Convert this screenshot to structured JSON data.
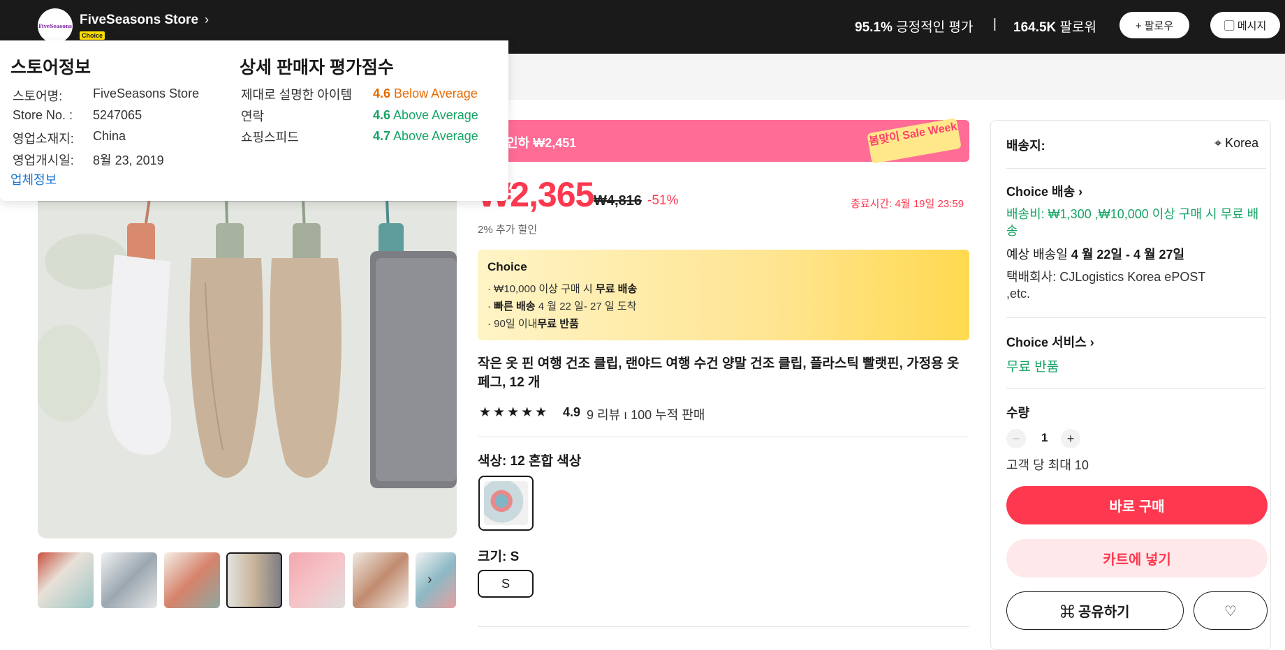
{
  "header": {
    "store_logo_text": "FiveSeasons",
    "store_name": "FiveSeasons Store",
    "choice_badge": "Choice",
    "positive_rate": "95.1%",
    "positive_label": " 긍정적인 평가",
    "separator": "|",
    "followers": "164.5K",
    "followers_label": " 팔로워",
    "follow_button": "+ 팔로우",
    "message_button": "▢ 메시지"
  },
  "store_popover": {
    "info_heading": "스토어정보",
    "info_rows": [
      {
        "label": "스토어명:",
        "value": "FiveSeasons Store"
      },
      {
        "label": "Store No. :",
        "value": "5247065"
      },
      {
        "label": "영업소재지:",
        "value": "China"
      },
      {
        "label": "영업개시일:",
        "value": "8월 23, 2019"
      }
    ],
    "business_info_link": "업체정보",
    "score_heading": "상세 판매자 평가점수",
    "scores": [
      {
        "label": "제대로 설명한 아이템",
        "score": "4.6",
        "status": "Below Average",
        "color": "#e66a00"
      },
      {
        "label": "연락",
        "score": "4.6",
        "status": "Above Average",
        "color": "#17a365"
      },
      {
        "label": "쇼핑스피드",
        "score": "4.7",
        "status": "Above Average",
        "color": "#17a365"
      }
    ]
  },
  "gallery": {
    "thumbnail_count": 7,
    "active_index": 3,
    "next_icon": "chevron-right-icon"
  },
  "product": {
    "promo_text": "가격인하 ₩2,451",
    "promo_tag": "봄맞이 Sale Week",
    "price": "₩2,365",
    "original_price": "₩4,816",
    "discount": "-51%",
    "end_time": "종료시간: 4월 19일 23:59",
    "extra_discount": "2% 추가 할인",
    "choice_title": "Choice",
    "choice_items": [
      {
        "pre": "· ₩10,000 이상 구매 시 ",
        "bold": "무료 배송",
        "post": ""
      },
      {
        "pre": "· ",
        "bold": "빠른 배송",
        "post": " 4 월 22 일- 27 일 도착"
      },
      {
        "pre": "· 90일 이내",
        "bold": "무료 반품",
        "post": ""
      }
    ],
    "title": "작은 옷 핀 여행 건조 클립, 랜야드 여행 수건 양말 건조 클립, 플라스틱 빨랫핀, 가정용 옷 페그, 12 개",
    "stars": "★★★★★",
    "rating": "4.9",
    "reviews": "9 리뷰  ı  100 누적 판매",
    "color_label": "색상: 12 혼합 색상",
    "size_label": "크기: S",
    "size_option": "S"
  },
  "shipping_panel": {
    "ship_to_label": "배송지:",
    "ship_to_value": "⌖ Korea",
    "choice_delivery": "Choice 배송  ›",
    "shipping_fee": "배송비: ₩1,300  ,₩10,000 이상 구매 시 무료 배송",
    "estimated_label": "예상 배송일 ",
    "estimated_value": "4 월 22일 - 4 월 27일",
    "courier": "택배회사: CJLogistics  Korea ePOST ,etc.",
    "choice_service": "Choice 서비스  ›",
    "free_return": "무료 반품",
    "quantity_label": "수량",
    "quantity": "1",
    "minus": "−",
    "plus": "+",
    "max_per_customer": "고객 당 최대 10",
    "buy_now": "바로 구매",
    "add_to_cart": "카트에 넣기",
    "share": "⌘ 공유하기",
    "wishlist": "♡"
  }
}
